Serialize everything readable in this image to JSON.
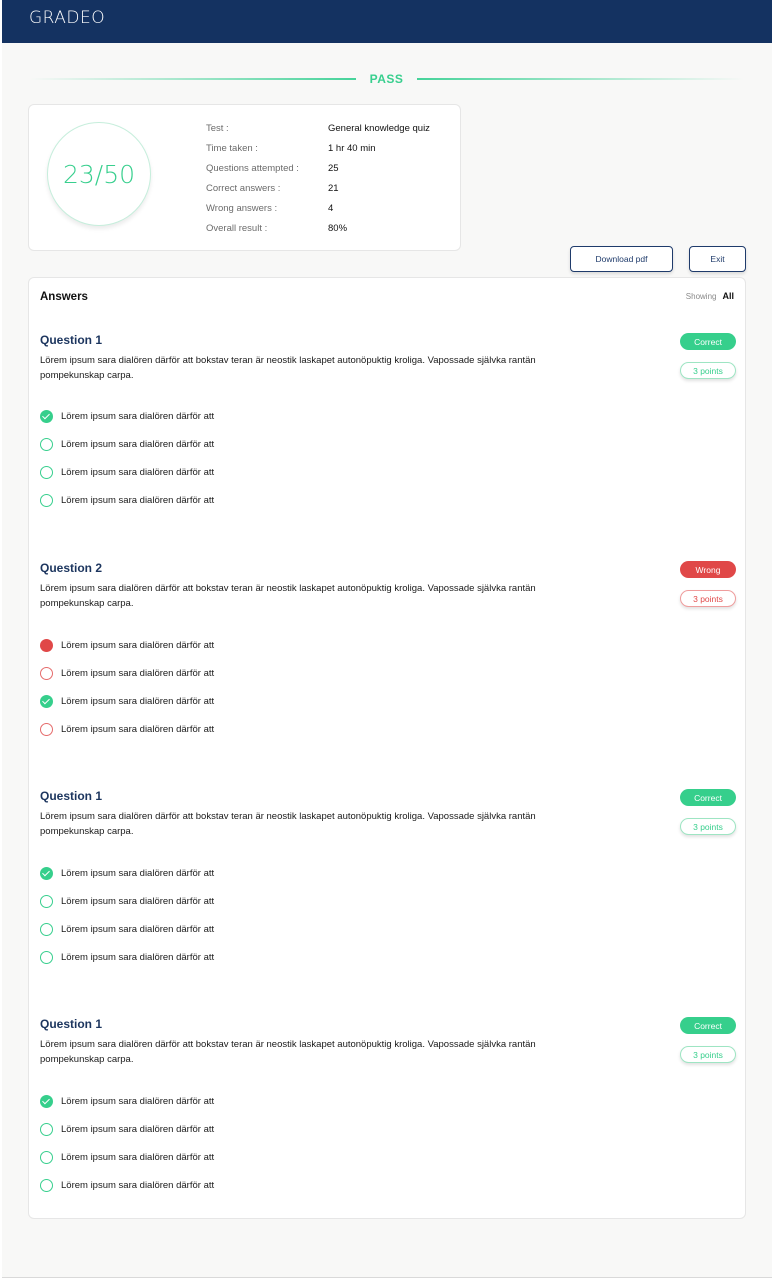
{
  "header": {
    "logo": "GRADEO"
  },
  "result": {
    "status": "PASS"
  },
  "summary": {
    "score": "23/50",
    "stats": [
      {
        "label": "Test :",
        "value": "General knowledge quiz"
      },
      {
        "label": "Time taken :",
        "value": "1 hr 40 min"
      },
      {
        "label": "Questions attempted :",
        "value": "25"
      },
      {
        "label": "Correct answers :",
        "value": "21"
      },
      {
        "label": "Wrong answers :",
        "value": "4"
      },
      {
        "label": "Overall result :",
        "value": "80%"
      }
    ]
  },
  "actions": {
    "download": "Download pdf",
    "exit": "Exit"
  },
  "answers": {
    "title": "Answers",
    "showing_label": "Showing",
    "showing_value": "All",
    "questions": [
      {
        "title": "Question 1",
        "text": "Lörem ipsum sara dialören därför att bokstav teran är neostik laskapet autonöpuktig kroliga. Vapossade självka rantän pompekunskap carpa.",
        "status": "Correct",
        "points": "3 points",
        "options": [
          "Lörem ipsum sara dialören därför att",
          "Lörem ipsum sara dialören därför att",
          "Lörem ipsum sara dialören därför att",
          "Lörem ipsum sara dialören därför att"
        ]
      },
      {
        "title": "Question 2",
        "text": "Lörem ipsum sara dialören därför att bokstav teran är neostik laskapet autonöpuktig kroliga. Vapossade självka rantän pompekunskap carpa.",
        "status": "Wrong",
        "points": "3 points",
        "options": [
          "Lörem ipsum sara dialören därför att",
          "Lörem ipsum sara dialören därför att",
          "Lörem ipsum sara dialören därför att",
          "Lörem ipsum sara dialören därför att"
        ]
      },
      {
        "title": "Question 1",
        "text": "Lörem ipsum sara dialören därför att bokstav teran är neostik laskapet autonöpuktig kroliga. Vapossade självka rantän pompekunskap carpa.",
        "status": "Correct",
        "points": "3 points",
        "options": [
          "Lörem ipsum sara dialören därför att",
          "Lörem ipsum sara dialören därför att",
          "Lörem ipsum sara dialören därför att",
          "Lörem ipsum sara dialören därför att"
        ]
      },
      {
        "title": "Question 1",
        "text": "Lörem ipsum sara dialören därför att bokstav teran är neostik laskapet autonöpuktig kroliga. Vapossade självka rantän pompekunskap carpa.",
        "status": "Correct",
        "points": "3 points",
        "options": [
          "Lörem ipsum sara dialören därför att",
          "Lörem ipsum sara dialören därför att",
          "Lörem ipsum sara dialören därför att",
          "Lörem ipsum sara dialören därför att"
        ]
      }
    ]
  },
  "colors": {
    "brand_navy": "#143261",
    "correct_green": "#36cf8c",
    "wrong_red": "#e04848"
  },
  "icons": {
    "selected_correct": "check-circle-icon",
    "selected_wrong": "filled-circle-icon",
    "unselected": "empty-circle-icon"
  }
}
